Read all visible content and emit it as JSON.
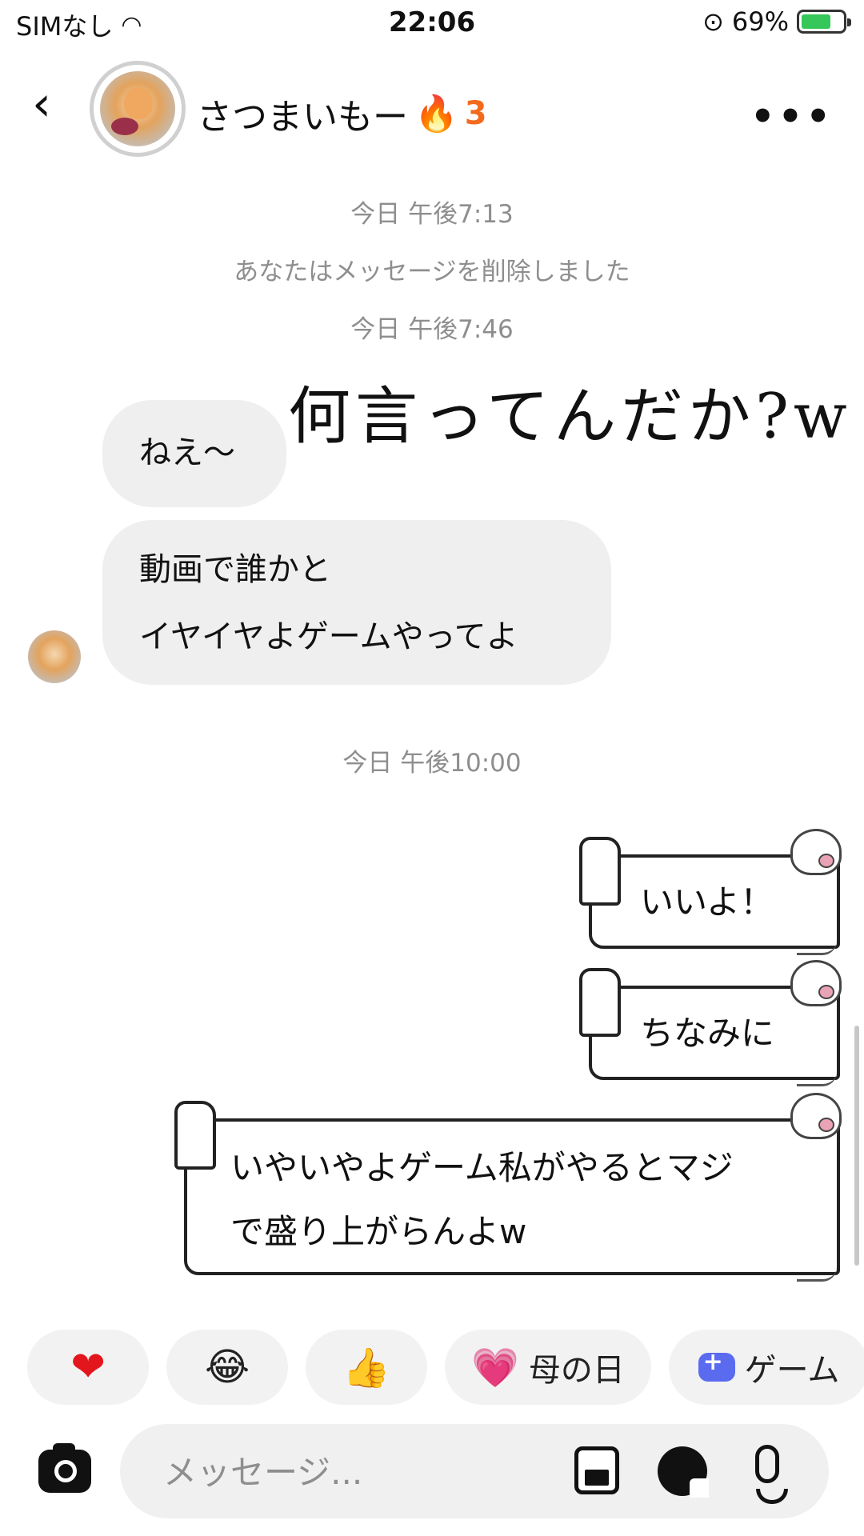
{
  "status_bar": {
    "carrier": "SIMなし",
    "time": "22:06",
    "battery": "69%",
    "battery_level": 0.69
  },
  "header": {
    "back_icon": "chevron-left-icon",
    "name": "さつまいもー",
    "streak_emoji": "🔥",
    "streak_count": "3",
    "more_icon": "ellipsis-icon"
  },
  "messages": {
    "ts1": "今日 午後7:13",
    "deleted_notice": "あなたはメッセージを削除しました",
    "ts2": "今日 午後7:46",
    "handwritten": "何言ってんだか?w",
    "recv1": "ねえ〜",
    "recv2_line1": "動画で誰かと",
    "recv2_line2": "イヤイヤよゲームやってよ",
    "ts3": "今日 午後10:00",
    "sent1": "いいよ！",
    "sent2": "ちなみに",
    "sent3_line1": "いやいやよゲーム私がやるとマジ",
    "sent3_line2": "で盛り上がらんよw"
  },
  "quick_reactions": {
    "heart": "❤",
    "laugh": "😂",
    "thumbs": "👍",
    "mothers_day_emoji": "💗",
    "mothers_day_label": "母の日",
    "game_label": "ゲーム"
  },
  "composer": {
    "placeholder": "メッセージ..."
  },
  "colors": {
    "bubble_in": "#efefef",
    "streak": "#f26b1d",
    "timestamp": "#8e8e8e",
    "game_icon": "#5b6bf0"
  }
}
